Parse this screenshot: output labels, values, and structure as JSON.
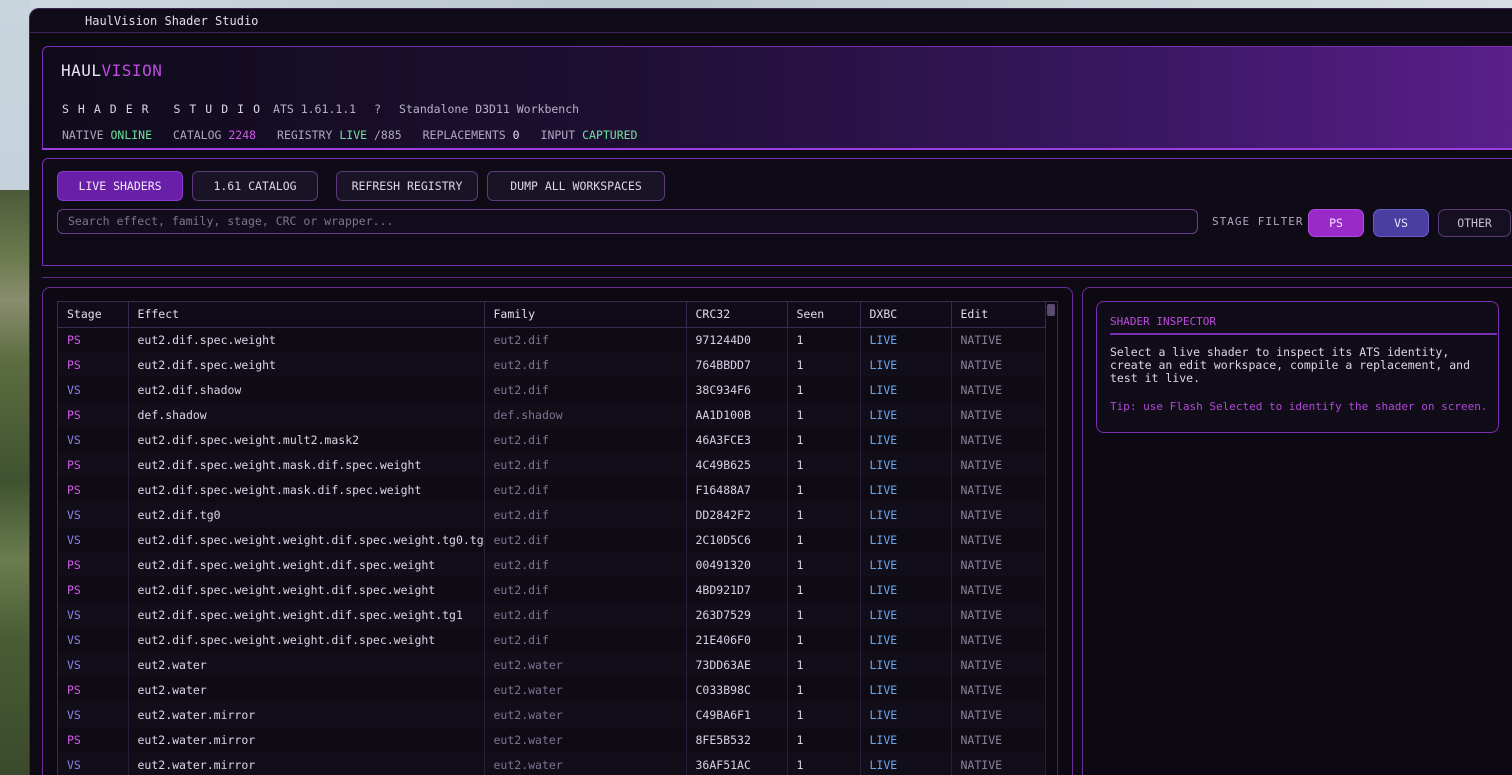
{
  "window": {
    "title": "HaulVision Shader Studio"
  },
  "header": {
    "logo_part1": "HAUL",
    "logo_part2": "VISION",
    "studio": "SHADER STUDIO",
    "version": "ATS 1.61.1.1",
    "help": "?",
    "mode": "Standalone D3D11 Workbench",
    "status": {
      "native_label": "NATIVE",
      "native_value": "ONLINE",
      "catalog_label": "CATALOG",
      "catalog_value": "2248",
      "registry_label": "REGISTRY",
      "registry_value": "LIVE",
      "registry_total": "/885",
      "replacements_label": "REPLACEMENTS",
      "replacements_value": "0",
      "input_label": "INPUT",
      "input_value": "CAPTURED"
    }
  },
  "toolbar": {
    "live_shaders": "LIVE SHADERS",
    "catalog": "1.61 CATALOG",
    "refresh": "REFRESH REGISTRY",
    "dump": "DUMP ALL WORKSPACES",
    "search_placeholder": "Search effect, family, stage, CRC or wrapper...",
    "stage_filter_label": "STAGE FILTER",
    "filter_ps": "PS",
    "filter_vs": "VS",
    "filter_other": "OTHER"
  },
  "table": {
    "columns": [
      "Stage",
      "Effect",
      "Family",
      "CRC32",
      "Seen",
      "DXBC",
      "Edit"
    ],
    "rows": [
      {
        "stage": "PS",
        "effect": "eut2.dif.spec.weight",
        "family": "eut2.dif",
        "crc": "971244D0",
        "seen": "1",
        "dxbc": "LIVE",
        "edit": "NATIVE"
      },
      {
        "stage": "PS",
        "effect": "eut2.dif.spec.weight",
        "family": "eut2.dif",
        "crc": "764BBDD7",
        "seen": "1",
        "dxbc": "LIVE",
        "edit": "NATIVE"
      },
      {
        "stage": "VS",
        "effect": "eut2.dif.shadow",
        "family": "eut2.dif",
        "crc": "38C934F6",
        "seen": "1",
        "dxbc": "LIVE",
        "edit": "NATIVE"
      },
      {
        "stage": "PS",
        "effect": "def.shadow",
        "family": "def.shadow",
        "crc": "AA1D100B",
        "seen": "1",
        "dxbc": "LIVE",
        "edit": "NATIVE"
      },
      {
        "stage": "VS",
        "effect": "eut2.dif.spec.weight.mult2.mask2",
        "family": "eut2.dif",
        "crc": "46A3FCE3",
        "seen": "1",
        "dxbc": "LIVE",
        "edit": "NATIVE"
      },
      {
        "stage": "PS",
        "effect": "eut2.dif.spec.weight.mask.dif.spec.weight",
        "family": "eut2.dif",
        "crc": "4C49B625",
        "seen": "1",
        "dxbc": "LIVE",
        "edit": "NATIVE"
      },
      {
        "stage": "PS",
        "effect": "eut2.dif.spec.weight.mask.dif.spec.weight",
        "family": "eut2.dif",
        "crc": "F16488A7",
        "seen": "1",
        "dxbc": "LIVE",
        "edit": "NATIVE"
      },
      {
        "stage": "VS",
        "effect": "eut2.dif.tg0",
        "family": "eut2.dif",
        "crc": "DD2842F2",
        "seen": "1",
        "dxbc": "LIVE",
        "edit": "NATIVE"
      },
      {
        "stage": "VS",
        "effect": "eut2.dif.spec.weight.weight.dif.spec.weight.tg0.tg",
        "family": "eut2.dif",
        "crc": "2C10D5C6",
        "seen": "1",
        "dxbc": "LIVE",
        "edit": "NATIVE"
      },
      {
        "stage": "PS",
        "effect": "eut2.dif.spec.weight.weight.dif.spec.weight",
        "family": "eut2.dif",
        "crc": "00491320",
        "seen": "1",
        "dxbc": "LIVE",
        "edit": "NATIVE"
      },
      {
        "stage": "PS",
        "effect": "eut2.dif.spec.weight.weight.dif.spec.weight",
        "family": "eut2.dif",
        "crc": "4BD921D7",
        "seen": "1",
        "dxbc": "LIVE",
        "edit": "NATIVE"
      },
      {
        "stage": "VS",
        "effect": "eut2.dif.spec.weight.weight.dif.spec.weight.tg1",
        "family": "eut2.dif",
        "crc": "263D7529",
        "seen": "1",
        "dxbc": "LIVE",
        "edit": "NATIVE"
      },
      {
        "stage": "VS",
        "effect": "eut2.dif.spec.weight.weight.dif.spec.weight",
        "family": "eut2.dif",
        "crc": "21E406F0",
        "seen": "1",
        "dxbc": "LIVE",
        "edit": "NATIVE"
      },
      {
        "stage": "VS",
        "effect": "eut2.water",
        "family": "eut2.water",
        "crc": "73DD63AE",
        "seen": "1",
        "dxbc": "LIVE",
        "edit": "NATIVE"
      },
      {
        "stage": "PS",
        "effect": "eut2.water",
        "family": "eut2.water",
        "crc": "C033B98C",
        "seen": "1",
        "dxbc": "LIVE",
        "edit": "NATIVE"
      },
      {
        "stage": "VS",
        "effect": "eut2.water.mirror",
        "family": "eut2.water",
        "crc": "C49BA6F1",
        "seen": "1",
        "dxbc": "LIVE",
        "edit": "NATIVE"
      },
      {
        "stage": "PS",
        "effect": "eut2.water.mirror",
        "family": "eut2.water",
        "crc": "8FE5B532",
        "seen": "1",
        "dxbc": "LIVE",
        "edit": "NATIVE"
      },
      {
        "stage": "VS",
        "effect": "eut2.water.mirror",
        "family": "eut2.water",
        "crc": "36AF51AC",
        "seen": "1",
        "dxbc": "LIVE",
        "edit": "NATIVE"
      }
    ]
  },
  "inspector": {
    "title": "SHADER INSPECTOR",
    "text": "Select a live shader to inspect its ATS identity, create an edit workspace, compile a replacement, and test it live.",
    "tip": "Tip: use Flash Selected to identify the shader on screen."
  },
  "colors": {
    "accent": "#c04be0",
    "online": "#6fe39a",
    "live": "#6aa8f0",
    "ps": "#d45ae8",
    "vs": "#8a84e8"
  }
}
